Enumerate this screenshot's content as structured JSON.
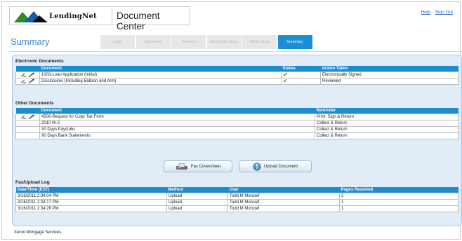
{
  "header": {
    "brand": "LendingNet",
    "app_title": "Document Center",
    "links": [
      {
        "label": "Help"
      },
      {
        "label": "Sign Out"
      }
    ]
  },
  "nav": {
    "page_title": "Summary",
    "tabs": [
      {
        "label": "Login",
        "active": false
      },
      {
        "label": "Overview",
        "active": false
      },
      {
        "label": "Consent",
        "active": false
      },
      {
        "label": "Electronic Docs",
        "active": false
      },
      {
        "label": "Other Docs",
        "active": false
      },
      {
        "label": "Summary",
        "active": true
      }
    ]
  },
  "electronic_documents": {
    "title": "Electronic Documents",
    "columns": [
      "Document",
      "Status",
      "Action Taken"
    ],
    "rows": [
      {
        "document": "1003-Loan Application (Initial)",
        "status_icon": "check-icon",
        "action": "Electronically Signed"
      },
      {
        "document": "Disclosures (Including Balloon and Arm)",
        "status_icon": "check-icon",
        "action": "Reviewed"
      }
    ]
  },
  "other_documents": {
    "title": "Other Documents",
    "columns": [
      "Document",
      "Reminder"
    ],
    "rows": [
      {
        "document": "4506-Request for Copy Tax Form",
        "reminder": "Print, Sign & Return",
        "icon": "sign-pen-icon"
      },
      {
        "document": "2010 W-2",
        "reminder": "Collect & Return",
        "icon": ""
      },
      {
        "document": "30 Days Paystubs",
        "reminder": "Collect & Return",
        "icon": ""
      },
      {
        "document": "90 Days Bank Statements",
        "reminder": "Collect & Return",
        "icon": ""
      }
    ]
  },
  "buttons": {
    "fax": "Fax Coversheet",
    "upload": "Upload Document"
  },
  "log": {
    "title": "Fax/Upload Log",
    "columns": [
      "Date/Time (EST)",
      "Method",
      "User",
      "Pages Received"
    ],
    "rows": [
      {
        "datetime": "3/16/2011 2:34:04 PM",
        "method": "Upload",
        "user": "Todd M Moncief",
        "pages": "2"
      },
      {
        "datetime": "3/16/2011 2:34:17 PM",
        "method": "Upload",
        "user": "Todd M Moncief",
        "pages": "1"
      },
      {
        "datetime": "3/16/2011 2:34:26 PM",
        "method": "Upload",
        "user": "Todd M Moncief",
        "pages": "1"
      }
    ]
  },
  "footer": "Xerox Mortgage Services",
  "colors": {
    "accent": "#1c8dd3",
    "panel": "#e1ecf7",
    "logo_green": "#2f8a2a",
    "logo_blue": "#1a5ea8",
    "check": "#5caa1e"
  }
}
